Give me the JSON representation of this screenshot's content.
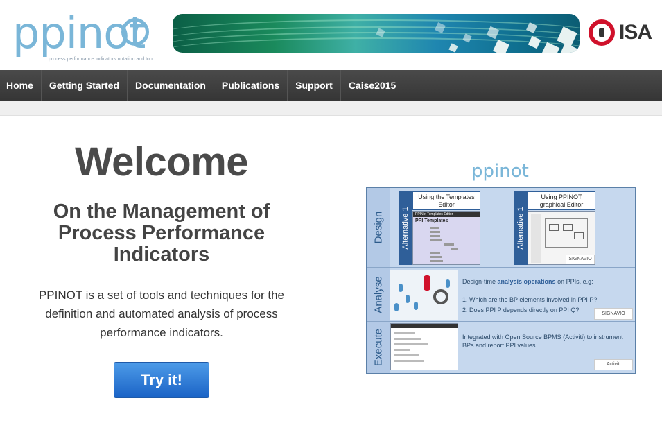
{
  "header": {
    "logo_text": "ppinot",
    "logo_tagline": "process performance indicators notation and tool",
    "partner_logo": "ISA"
  },
  "nav": {
    "items": [
      {
        "label": "Home"
      },
      {
        "label": "Getting Started"
      },
      {
        "label": "Documentation"
      },
      {
        "label": "Publications"
      },
      {
        "label": "Support"
      },
      {
        "label": "Caise2015"
      }
    ]
  },
  "main": {
    "welcome": "Welcome",
    "subtitle": "On the Management of Process Performance Indicators",
    "description": "PPINOT is a set of tools and techniques for the definition and automated analysis of process performance indicators.",
    "cta_label": "Try it!"
  },
  "figure": {
    "logo_text": "ppinot",
    "rows": {
      "design": {
        "label": "Design",
        "alt1_label": "Alternative 1",
        "templates_title": "Using the Templates Editor",
        "templates_panel_bar": "PPINot Templates Editor",
        "templates_panel_heading": "PPI Templates",
        "alt2_label": "Alternative 1",
        "graphical_title": "Using PPINOT graphical Editor",
        "brand": "SIGNAVIO"
      },
      "analyse": {
        "label": "Analyse",
        "intro_prefix": "Design-time ",
        "intro_bold": "analysis operations",
        "intro_suffix": " on PPIs, e.g:",
        "item1": "1.   Which are the BP elements involved in PPI P?",
        "item2": "2.   Does PPI P depends directly on PPI Q?",
        "brand": "SIGNAVIO"
      },
      "execute": {
        "label": "Execute",
        "text": "Integrated with Open Source BPMS (Activiti) to instrument BPs and report PPI values",
        "brand": "Activiti"
      }
    }
  },
  "colors": {
    "nav_bg": "#3e3e3e",
    "cta_bg": "#2b7bd8",
    "figure_bg": "#c6d8ee",
    "figure_accent": "#2f5f99",
    "logo_blue": "#7ab6d8",
    "isa_red": "#d0112b"
  }
}
